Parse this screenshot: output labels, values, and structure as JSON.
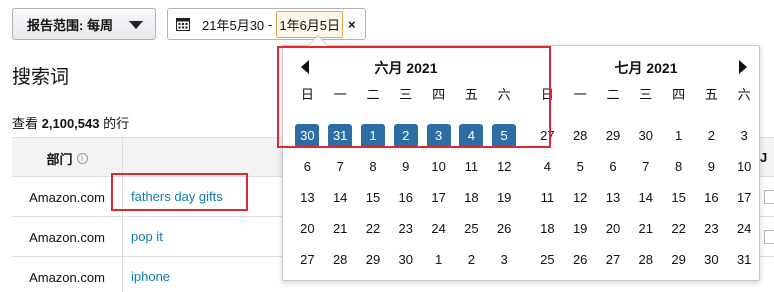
{
  "toolbar": {
    "range_label": "报告范围: 每周",
    "start_date": "21年5月30日",
    "date_sep": "-",
    "end_date": "1年6月5日",
    "clear": "×"
  },
  "page": {
    "title": "搜索词",
    "row_count_prefix": "查看",
    "row_count": "2,100,543",
    "row_count_suffix": "的行"
  },
  "table": {
    "header_dept": "部门",
    "header_right": "J",
    "rows": [
      {
        "dept": "Amazon.com",
        "term": "fathers day gifts"
      },
      {
        "dept": "Amazon.com",
        "term": "pop it"
      },
      {
        "dept": "Amazon.com",
        "term": "iphone"
      }
    ]
  },
  "calendar": {
    "weekdays": [
      "日",
      "一",
      "二",
      "三",
      "四",
      "五",
      "六"
    ],
    "left": {
      "title": "六月 2021",
      "weeks": [
        [
          "30",
          "31",
          "1",
          "2",
          "3",
          "4",
          "5"
        ],
        [
          "6",
          "7",
          "8",
          "9",
          "10",
          "11",
          "12"
        ],
        [
          "13",
          "14",
          "15",
          "16",
          "17",
          "18",
          "19"
        ],
        [
          "20",
          "21",
          "22",
          "23",
          "24",
          "25",
          "26"
        ],
        [
          "27",
          "28",
          "29",
          "30",
          "1",
          "2",
          "3"
        ]
      ],
      "selected_week": 0
    },
    "right": {
      "title": "七月 2021",
      "weeks": [
        [
          "27",
          "28",
          "29",
          "30",
          "1",
          "2",
          "3"
        ],
        [
          "4",
          "5",
          "6",
          "7",
          "8",
          "9",
          "10"
        ],
        [
          "11",
          "12",
          "13",
          "14",
          "15",
          "16",
          "17"
        ],
        [
          "18",
          "19",
          "20",
          "21",
          "22",
          "23",
          "24"
        ],
        [
          "25",
          "26",
          "27",
          "28",
          "29",
          "30",
          "31"
        ]
      ],
      "selected_week": -1
    }
  },
  "colors": {
    "selected_day": "#2e6da4",
    "highlight_box": "#e0282e",
    "link": "#0f7fa8"
  }
}
